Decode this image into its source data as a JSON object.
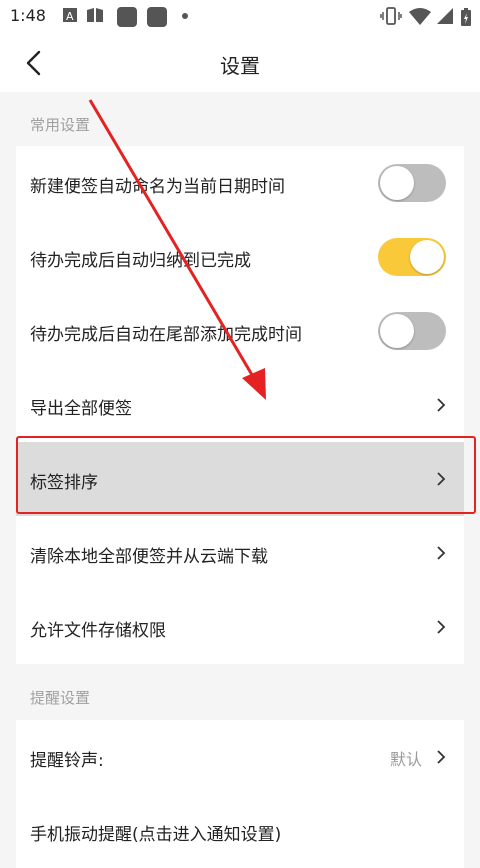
{
  "status": {
    "time": "1:48",
    "icons": [
      "a-icon",
      "book-icon",
      "app-square-icon",
      "app-square-icon",
      "dot-icon",
      "vibrate-icon",
      "wifi-icon",
      "signal-icon",
      "battery-icon"
    ]
  },
  "header": {
    "title": "设置",
    "back_icon": "chevron-left-icon"
  },
  "sections": {
    "common": {
      "label": "常用设置",
      "items": [
        {
          "label": "新建便签自动命名为当前日期时间",
          "type": "toggle",
          "on": false
        },
        {
          "label": "待办完成后自动归纳到已完成",
          "type": "toggle",
          "on": true
        },
        {
          "label": "待办完成后自动在尾部添加完成时间",
          "type": "toggle",
          "on": false
        },
        {
          "label": "导出全部便签",
          "type": "link"
        },
        {
          "label": "标签排序",
          "type": "link",
          "highlighted": true
        },
        {
          "label": "清除本地全部便签并从云端下载",
          "type": "link"
        },
        {
          "label": "允许文件存储权限",
          "type": "link"
        }
      ]
    },
    "reminder": {
      "label": "提醒设置",
      "items": [
        {
          "label": "提醒铃声:",
          "type": "link",
          "value": "默认"
        },
        {
          "label": "手机振动提醒(点击进入通知设置)",
          "type": "link"
        }
      ]
    }
  },
  "colors": {
    "accent": "#f9c93a",
    "toggle_off": "#bdbdbd",
    "highlight_row": "#dcdcdc",
    "annotation_red": "#e52222",
    "background": "#f5f5f5"
  }
}
